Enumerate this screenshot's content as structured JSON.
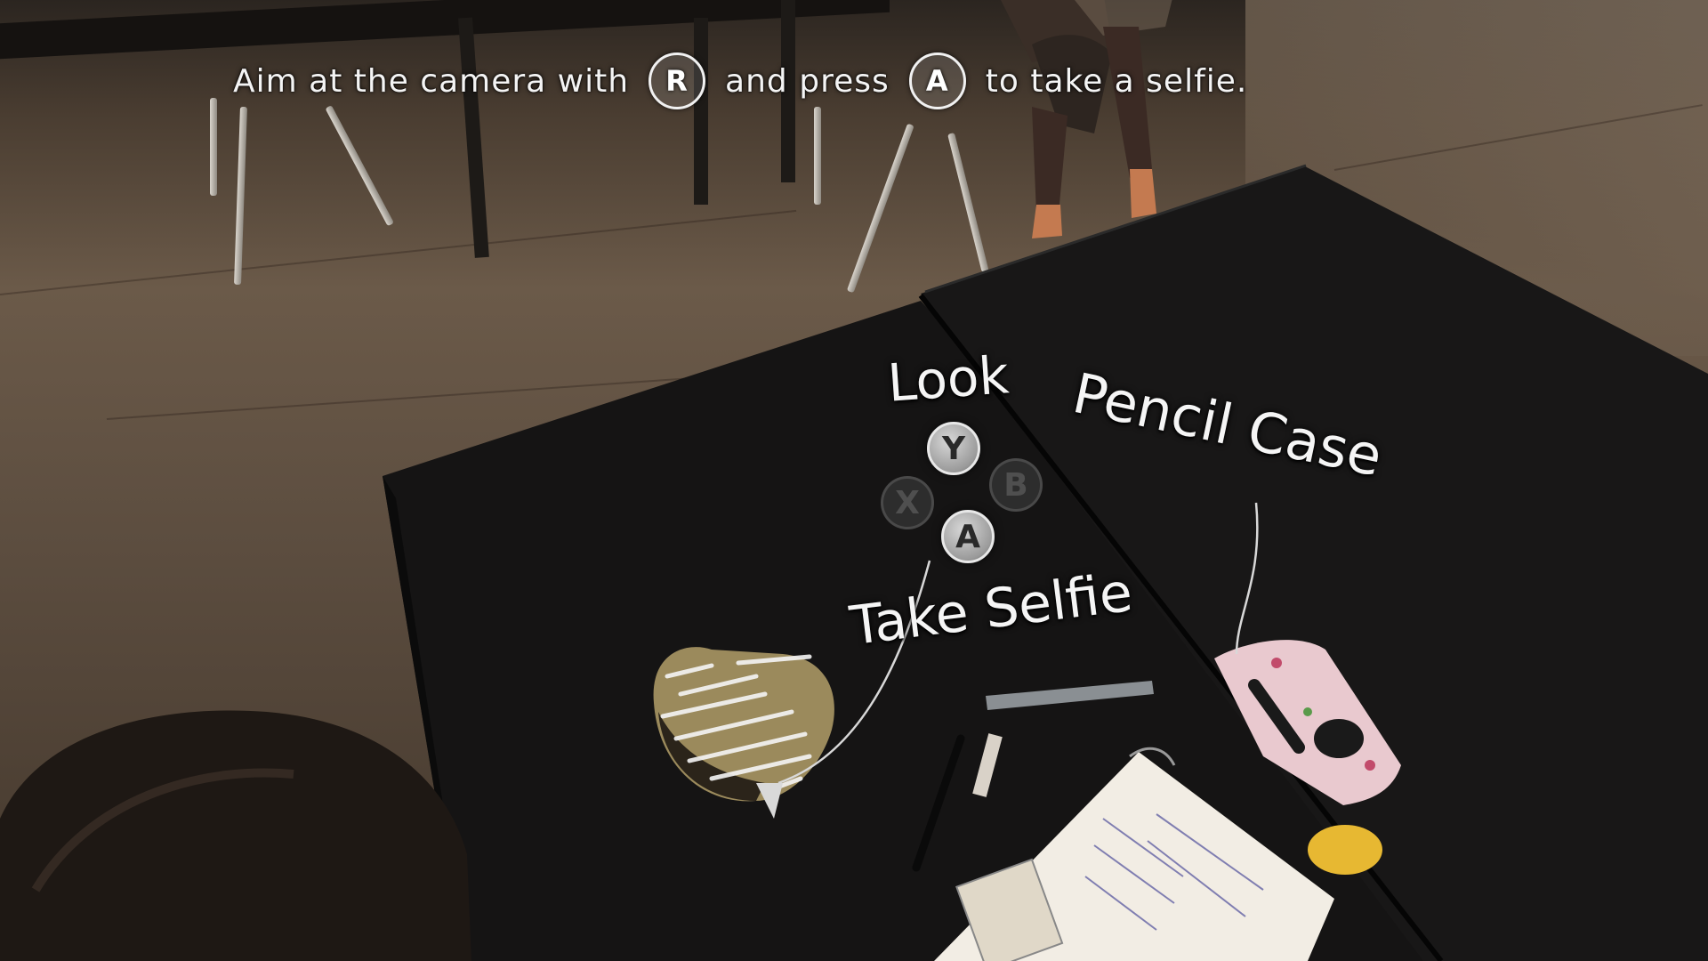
{
  "hint": {
    "prefix": "Aim at the camera with",
    "aim_button": "R",
    "middle": "and press",
    "action_button": "A",
    "suffix": "to take a selfie."
  },
  "interaction_wheel": {
    "top_button": "Y",
    "left_button": "X",
    "right_button": "B",
    "bottom_button": "A"
  },
  "labels": {
    "look": "Look",
    "pencil_case": "Pencil Case",
    "take_selfie": "Take Selfie"
  },
  "colors": {
    "desk": "#151414",
    "hint_text": "#f4f4f4",
    "label_text": "#f5f5f5"
  }
}
